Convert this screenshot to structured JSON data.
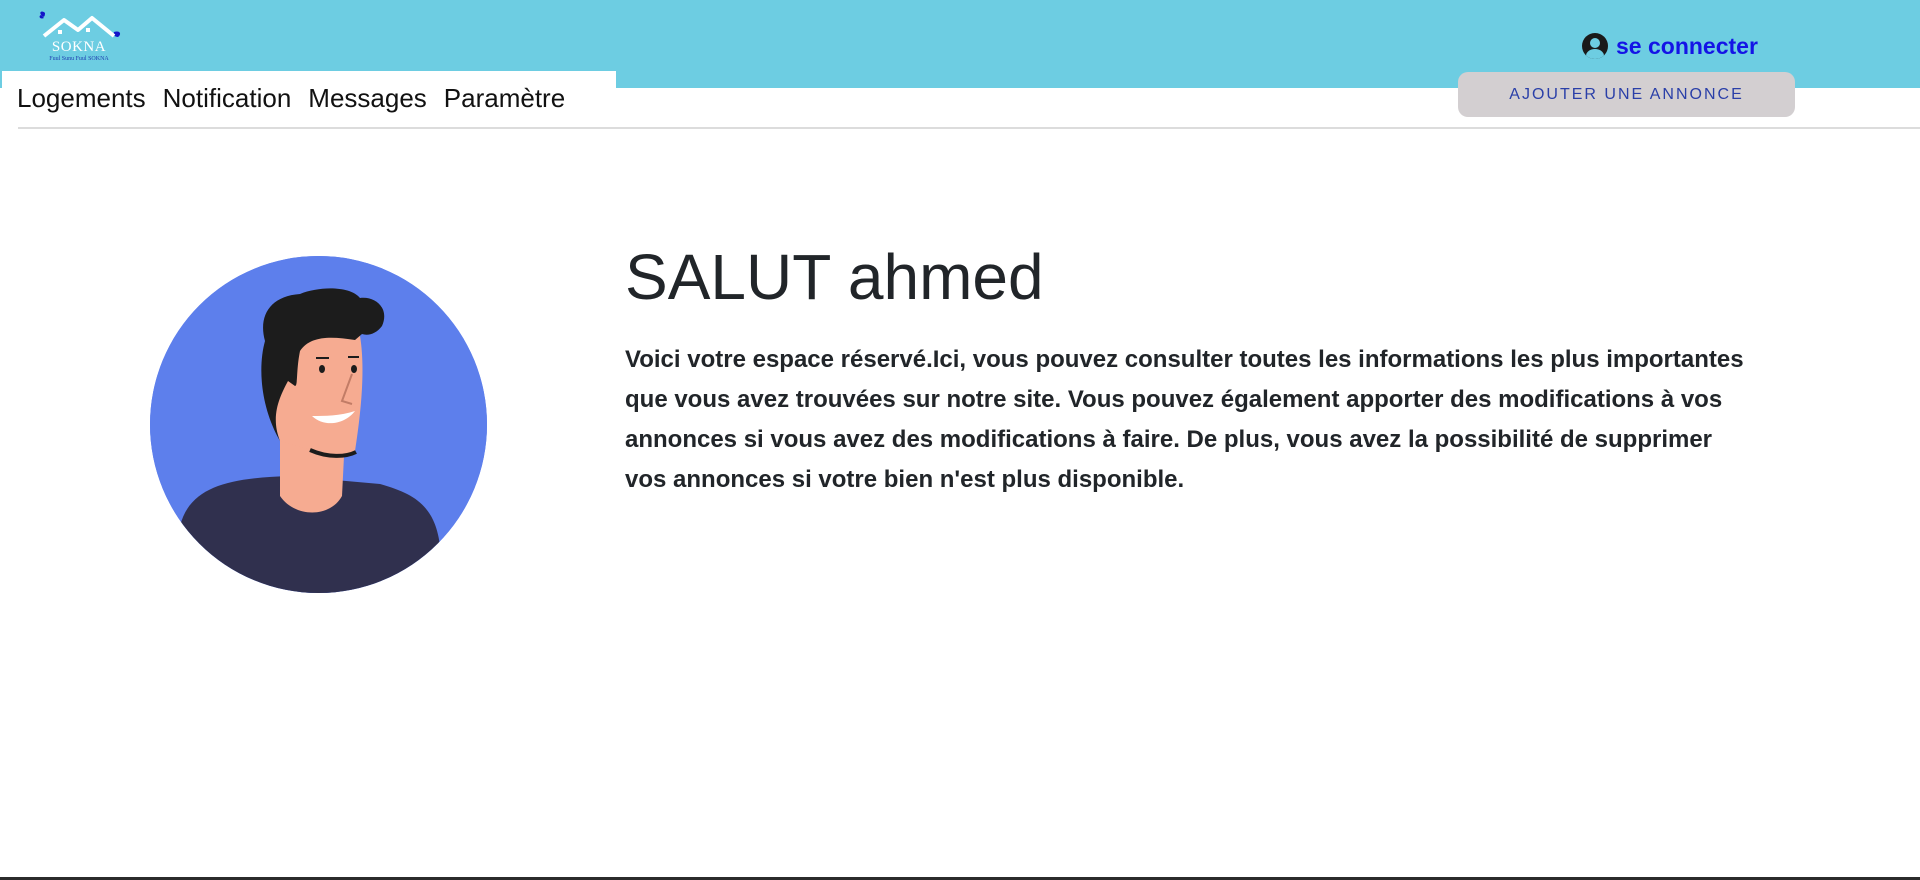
{
  "header": {
    "logo": {
      "brand": "SOKNA",
      "tagline": "Fuul Sunu Fuul SOKNA"
    },
    "login_label": "se connecter",
    "background_color": "#6dcde2",
    "login_color": "#1414e6"
  },
  "nav": {
    "items": [
      {
        "label": "Logements"
      },
      {
        "label": "Notification"
      },
      {
        "label": "Messages"
      },
      {
        "label": "Paramètre"
      }
    ]
  },
  "actions": {
    "add_listing_label": "AJOUTER UNE ANNONCE"
  },
  "profile": {
    "greeting": "SALUT ahmed",
    "intro": "Voici votre espace réservé.Ici, vous pouvez consulter toutes les informations les plus importantes que vous avez trouvées sur notre site. Vous pouvez également apporter des modifications à vos annonces si vous avez des modifications à faire. De plus, vous avez la possibilité de supprimer vos annonces si votre bien n'est plus disponible.",
    "avatar_icon": "user-avatar-illustration",
    "avatar_color": "#5d7fec"
  }
}
